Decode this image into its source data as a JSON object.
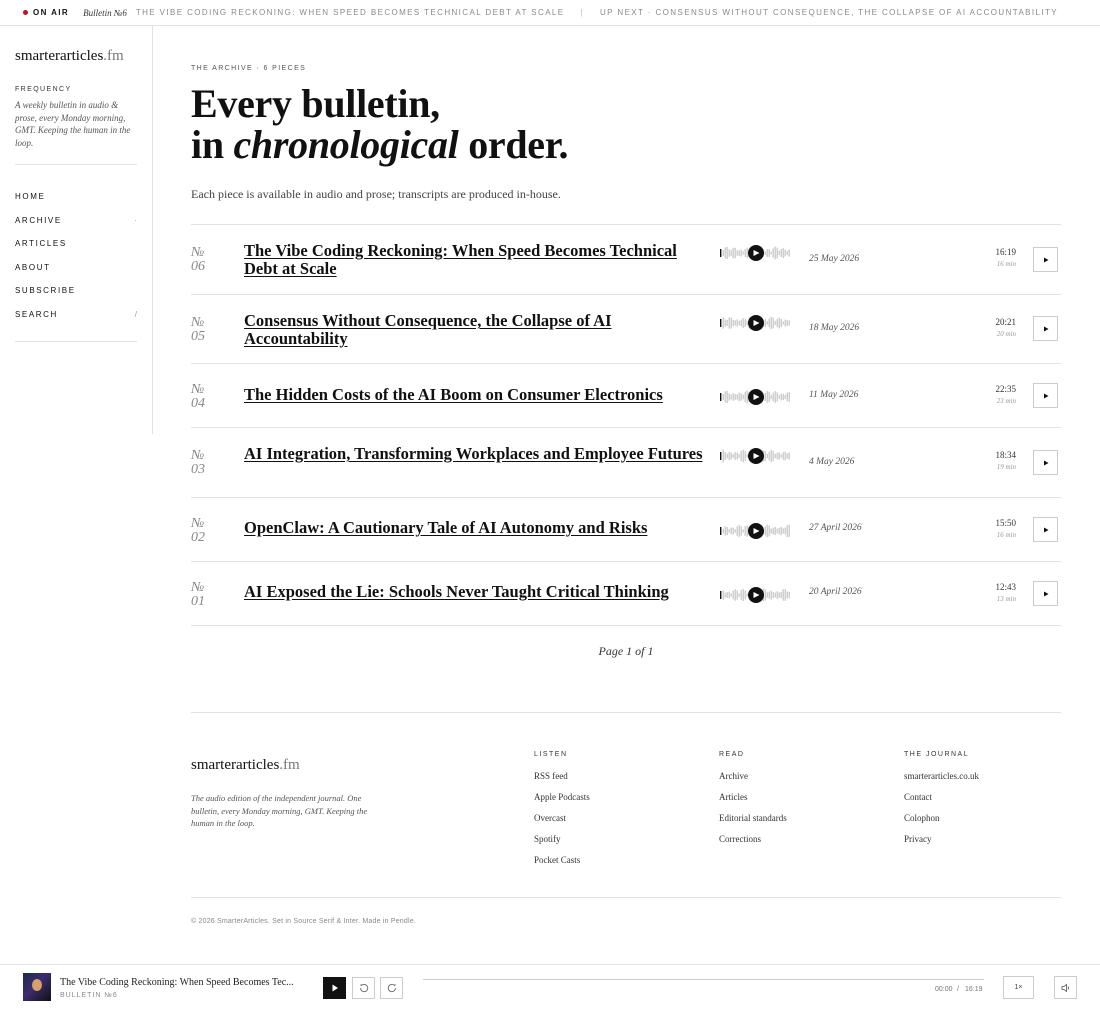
{
  "ticker": {
    "on_air": "ON AIR",
    "bulletin": "Bulletin №6",
    "now_playing": "THE VIBE CODING RECKONING: WHEN SPEED BECOMES TECHNICAL DEBT AT SCALE",
    "separator": "|",
    "up_next": "UP NEXT · CONSENSUS WITHOUT CONSEQUENCE, THE COLLAPSE OF AI ACCOUNTABILITY"
  },
  "sidebar": {
    "brand_main": "smarterarticles",
    "brand_suffix": ".fm",
    "frequency_label": "FREQUENCY",
    "frequency_text": "A weekly bulletin in audio & prose, every Monday morning, GMT. Keeping the human in the loop.",
    "nav": [
      {
        "label": "HOME",
        "mark": ""
      },
      {
        "label": "ARCHIVE",
        "mark": "·"
      },
      {
        "label": "ARTICLES",
        "mark": ""
      },
      {
        "label": "ABOUT",
        "mark": ""
      },
      {
        "label": "SUBSCRIBE",
        "mark": ""
      },
      {
        "label": "SEARCH",
        "mark": "/"
      }
    ]
  },
  "main": {
    "eyebrow": "THE ARCHIVE · 6 PIECES",
    "headline_line1": "Every bulletin,",
    "headline_in": "in",
    "headline_em": "chronological",
    "headline_end": "order.",
    "intro": "Each piece is available in audio and prose; transcripts are produced in-house.",
    "pager": "Page 1 of 1"
  },
  "episodes": [
    {
      "no_label": "№",
      "no": "06",
      "title": "The Vibe Coding Reckoning: When Speed Becomes Technical Debt at Scale",
      "date": "25 May 2026",
      "time": "16:19",
      "minutes": "16 min"
    },
    {
      "no_label": "№",
      "no": "05",
      "title": "Consensus Without Consequence, the Collapse of AI Accountability",
      "date": "18 May 2026",
      "time": "20:21",
      "minutes": "20 min"
    },
    {
      "no_label": "№",
      "no": "04",
      "title": "The Hidden Costs of the AI Boom on Consumer Electronics",
      "date": "11 May 2026",
      "time": "22:35",
      "minutes": "23 min"
    },
    {
      "no_label": "№",
      "no": "03",
      "title": "AI Integration, Transforming Workplaces and Employee Futures",
      "date": "4 May 2026",
      "time": "18:34",
      "minutes": "19 min"
    },
    {
      "no_label": "№",
      "no": "02",
      "title": "OpenClaw: A Cautionary Tale of AI Autonomy and Risks",
      "date": "27 April 2026",
      "time": "15:50",
      "minutes": "16 min"
    },
    {
      "no_label": "№",
      "no": "01",
      "title": "AI Exposed the Lie: Schools Never Taught Critical Thinking",
      "date": "20 April 2026",
      "time": "12:43",
      "minutes": "13 min"
    }
  ],
  "footer": {
    "brand_main": "smarterarticles",
    "brand_suffix": ".fm",
    "description": "The audio edition of the independent journal. One bulletin, every Monday morning, GMT. Keeping the human in the loop.",
    "columns": [
      {
        "heading": "LISTEN",
        "links": [
          "RSS feed",
          "Apple Podcasts",
          "Overcast",
          "Spotify",
          "Pocket Casts"
        ]
      },
      {
        "heading": "READ",
        "links": [
          "Archive",
          "Articles",
          "Editorial standards",
          "Corrections"
        ]
      },
      {
        "heading": "THE JOURNAL",
        "links": [
          "smarterarticles.co.uk",
          "Contact",
          "Colophon",
          "Privacy"
        ]
      }
    ],
    "copyright": "© 2026 SmarterArticles. Set in Source Serif & Inter. Made in Pendle."
  },
  "player": {
    "title": "The Vibe Coding Reckoning: When Speed Becomes Tec...",
    "subtitle": "BULLETIN №6",
    "elapsed": "00:00",
    "time_sep": "/",
    "total": "16:19",
    "rate": "1×",
    "progress": 0
  },
  "icons": {
    "play": "play-icon",
    "rewind": "rewind-icon",
    "forward": "forward-icon",
    "volume": "volume-icon"
  },
  "colors": {
    "on_air_dot": "#c1121f",
    "accent": "#111111"
  }
}
